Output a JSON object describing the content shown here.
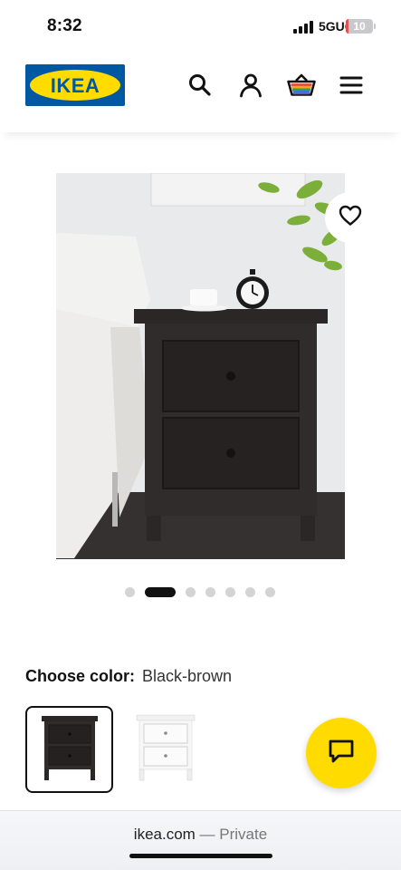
{
  "status_bar": {
    "time": "8:32",
    "network": "5GUC",
    "battery": "10",
    "battery_level": 0.1
  },
  "header": {
    "logo_text": "IKEA",
    "icons": [
      "search-icon",
      "account-icon",
      "cart-icon",
      "menu-icon"
    ]
  },
  "product": {
    "favorite_icon": "heart-icon",
    "image_count": 7,
    "active_image_index": 1
  },
  "color_picker": {
    "label": "Choose color:",
    "selected_value": "Black-brown",
    "options": [
      "Black-brown",
      "White"
    ]
  },
  "chat": {
    "icon": "chat-icon"
  },
  "browser": {
    "domain": "ikea.com",
    "separator": " — ",
    "mode": "Private"
  },
  "colors": {
    "ikea_blue": "#0058a3",
    "ikea_yellow": "#ffdb00",
    "dark_furniture": "#2a2726"
  }
}
